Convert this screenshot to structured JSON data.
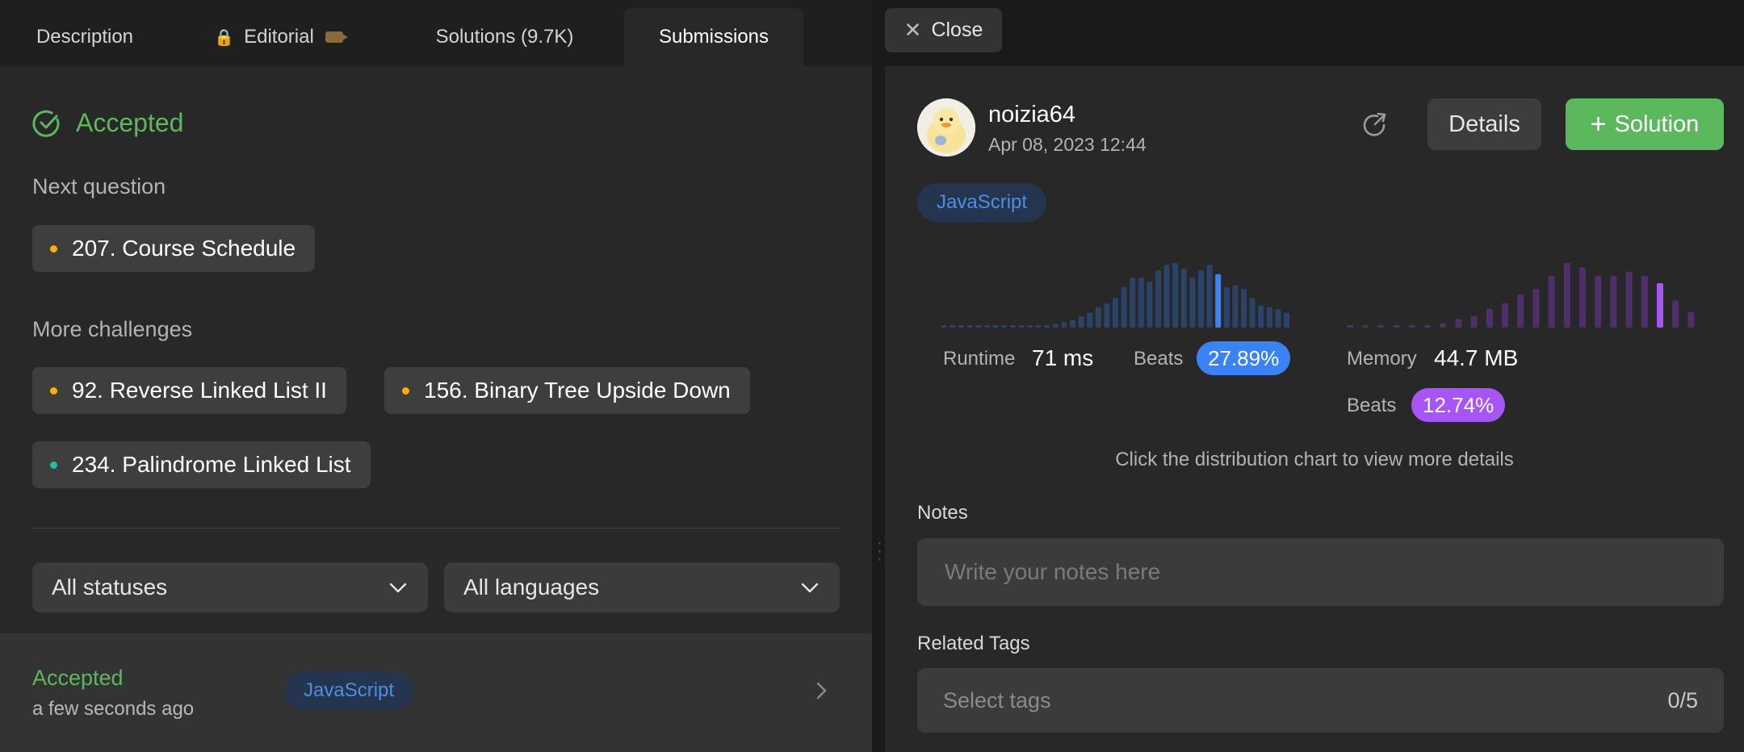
{
  "tabs": [
    {
      "label": "Description"
    },
    {
      "label": "Editorial"
    },
    {
      "label": "Solutions (9.7K)"
    },
    {
      "label": "Submissions"
    }
  ],
  "result": {
    "status": "Accepted",
    "color": "#5cb85c"
  },
  "next_question": {
    "label": "Next question",
    "item": {
      "title": "207. Course Schedule",
      "difficulty_color": "#f5b300"
    }
  },
  "more_challenges": {
    "label": "More challenges",
    "items": [
      {
        "title": "92. Reverse Linked List II",
        "difficulty_color": "#f5b300"
      },
      {
        "title": "156. Binary Tree Upside Down",
        "difficulty_color": "#f5b300"
      },
      {
        "title": "234. Palindrome Linked List",
        "difficulty_color": "#2cbba6"
      }
    ]
  },
  "filters": {
    "status": "All statuses",
    "language": "All languages"
  },
  "submission_row": {
    "status": "Accepted",
    "time": "a few seconds ago",
    "language": "JavaScript"
  },
  "close_label": "Close",
  "detail": {
    "username": "noizia64",
    "date": "Apr 08, 2023 12:44",
    "details_label": "Details",
    "solution_label": "Solution",
    "language": "JavaScript",
    "runtime": {
      "label": "Runtime",
      "value": "71 ms",
      "beats_label": "Beats",
      "beats": "27.89%",
      "color": "#3b82f6"
    },
    "memory": {
      "label": "Memory",
      "value": "44.7 MB",
      "beats_label": "Beats",
      "beats": "12.74%",
      "color": "#a855f7"
    },
    "hint": "Click the distribution chart to view more details",
    "notes_label": "Notes",
    "notes_placeholder": "Write your notes here",
    "tags_label": "Related Tags",
    "tags_placeholder": "Select tags",
    "tags_count": "0/5"
  },
  "runtime_distribution": [
    1,
    1,
    1,
    1,
    1,
    1,
    1,
    1,
    1,
    1,
    1,
    1,
    1,
    2,
    3,
    4,
    6,
    8,
    11,
    13,
    16,
    22,
    27,
    27,
    25,
    31,
    34,
    35,
    32,
    27,
    31,
    34,
    29,
    22,
    23,
    21,
    16,
    12,
    11,
    10,
    8
  ],
  "runtime_highlight_index": 32,
  "memory_distribution": [
    1,
    1,
    1,
    1,
    1,
    1,
    3,
    6,
    8,
    13,
    17,
    23,
    27,
    36,
    45,
    42,
    36,
    36,
    39,
    36,
    31,
    19,
    11
  ],
  "memory_highlight_index": 20
}
